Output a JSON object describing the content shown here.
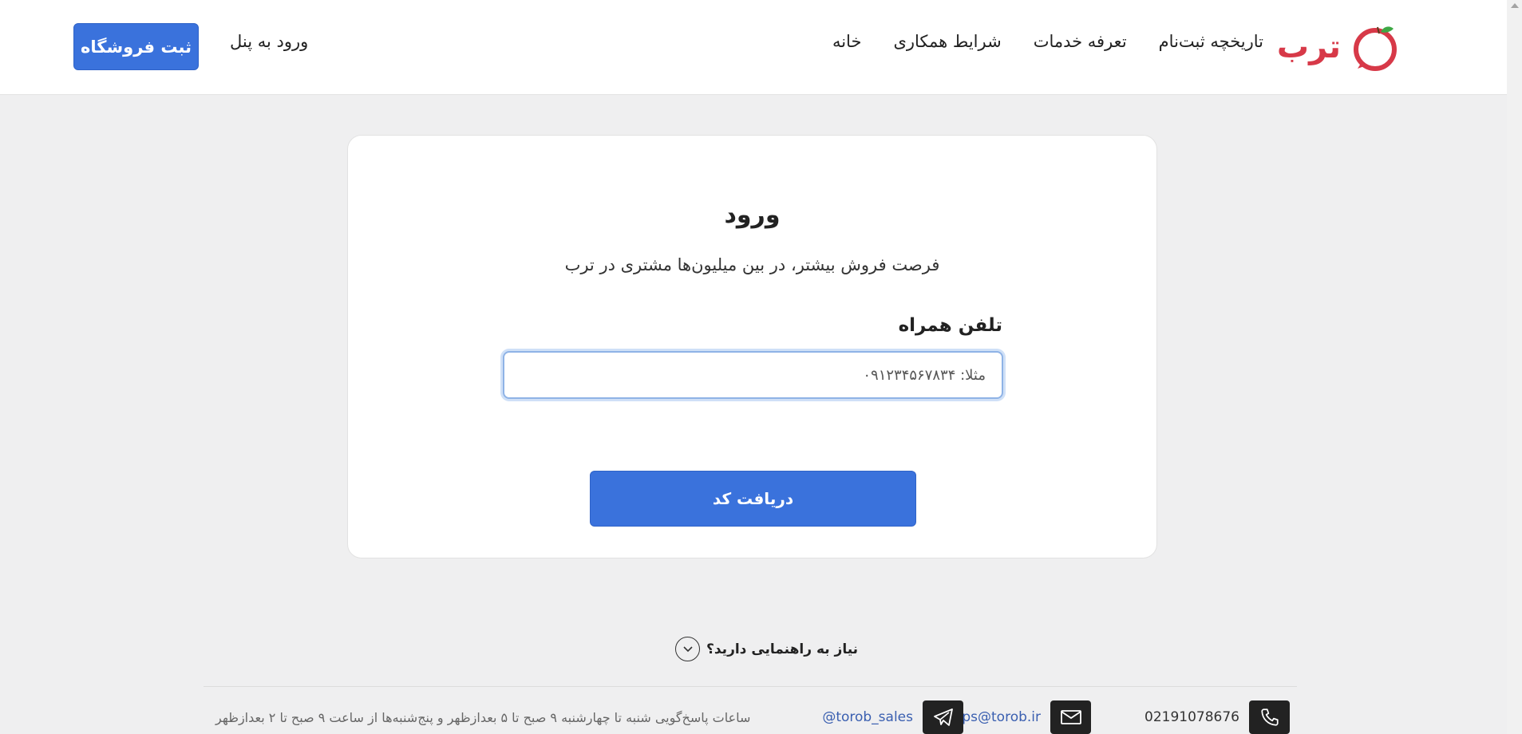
{
  "header": {
    "logo_text": "ترب",
    "nav": [
      {
        "label": "خانه"
      },
      {
        "label": "شرایط همکاری"
      },
      {
        "label": "تعرفه خدمات"
      },
      {
        "label": "تاریخچه ثبت‌نام"
      }
    ],
    "login_label": "ورود به پنل",
    "register_label": "ثبت فروشگاه"
  },
  "login_card": {
    "title": "ورود",
    "subtitle": "فرصت فروش بیشتر، در بین میلیون‌ها مشتری در ترب",
    "phone_label": "تلفن همراه",
    "phone_placeholder": "مثلا: ۰۹۱۲۳۴۵۶۷۸۳۴",
    "phone_value": "",
    "submit_label": "دریافت کد"
  },
  "help": {
    "label": "نیاز به راهنمایی دارید؟"
  },
  "footer": {
    "phone": "02191078676",
    "email": "shops@torob.ir",
    "telegram": "@torob_sales",
    "hours": "ساعات پاسخ‌گویی شنبه تا چهارشنبه ۹ صبح تا ۵ بعدازظهر و پنج‌شنبه‌ها از ساعت ۹ صبح تا ۲ بعدازظهر"
  },
  "colors": {
    "brand_red": "#d73948",
    "primary_blue": "#3a72dc",
    "background": "#efeff0"
  },
  "icons": [
    "torob-logo-icon",
    "chevron-down-icon",
    "phone-icon",
    "mail-icon",
    "telegram-icon"
  ]
}
